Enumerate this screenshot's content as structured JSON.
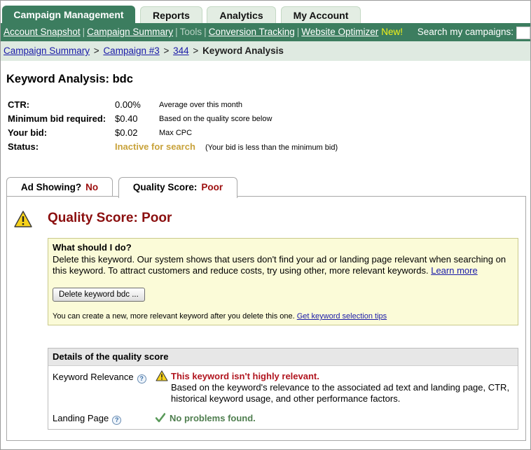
{
  "tabs": [
    {
      "label": "Campaign Management",
      "active": true
    },
    {
      "label": "Reports",
      "active": false
    },
    {
      "label": "Analytics",
      "active": false
    },
    {
      "label": "My Account",
      "active": false
    }
  ],
  "subnav": {
    "links": [
      "Account Snapshot",
      "Campaign Summary"
    ],
    "tools": "Tools",
    "links2": [
      "Conversion Tracking",
      "Website Optimizer"
    ],
    "new_badge": "New!",
    "search_label": "Search my campaigns:"
  },
  "breadcrumb": {
    "items": [
      "Campaign Summary",
      "Campaign #3",
      "344"
    ],
    "current": "Keyword Analysis"
  },
  "page": {
    "title": "Keyword Analysis: bdc"
  },
  "stats": [
    {
      "label": "CTR:",
      "value": "0.00%",
      "note": "Average over this month"
    },
    {
      "label": "Minimum bid required:",
      "value": "$0.40",
      "note": "Based on the quality score below"
    },
    {
      "label": "Your bid:",
      "value": "$0.02",
      "note": "Max CPC"
    },
    {
      "label": "Status:",
      "value": "Inactive for search",
      "note": "(Your bid is less than the minimum bid)"
    }
  ],
  "lower_tabs": [
    {
      "label": "Ad Showing?",
      "value": "No",
      "active": false
    },
    {
      "label": "Quality Score:",
      "value": "Poor",
      "active": true
    }
  ],
  "quality": {
    "title": "Quality Score: Poor",
    "what_title": "What should I do?",
    "what_body": "Delete this keyword. Our system shows that users don't find your ad or landing page relevant when searching on this keyword. To attract customers and reduce costs, try using other, more relevant keywords. ",
    "learn_more": "Learn more",
    "delete_button": "Delete keyword bdc ...",
    "footer_text": "You can create a new, more relevant keyword after you delete this one. ",
    "footer_link": "Get keyword selection tips"
  },
  "details": {
    "header": "Details of the quality score",
    "relevance_label": "Keyword Relevance",
    "relevance_title": "This keyword isn't highly relevant.",
    "relevance_body": "Based on the keyword's relevance to the associated ad text and landing page, CTR, historical keyword usage, and other performance factors.",
    "landing_label": "Landing Page",
    "landing_status": "No problems found.",
    "help_glyph": "?"
  },
  "colors": {
    "brand_green": "#3c7d5f",
    "poor_red": "#8b0f0f",
    "inactive_gold": "#c8a23a",
    "ok_green": "#4f7e4f"
  }
}
